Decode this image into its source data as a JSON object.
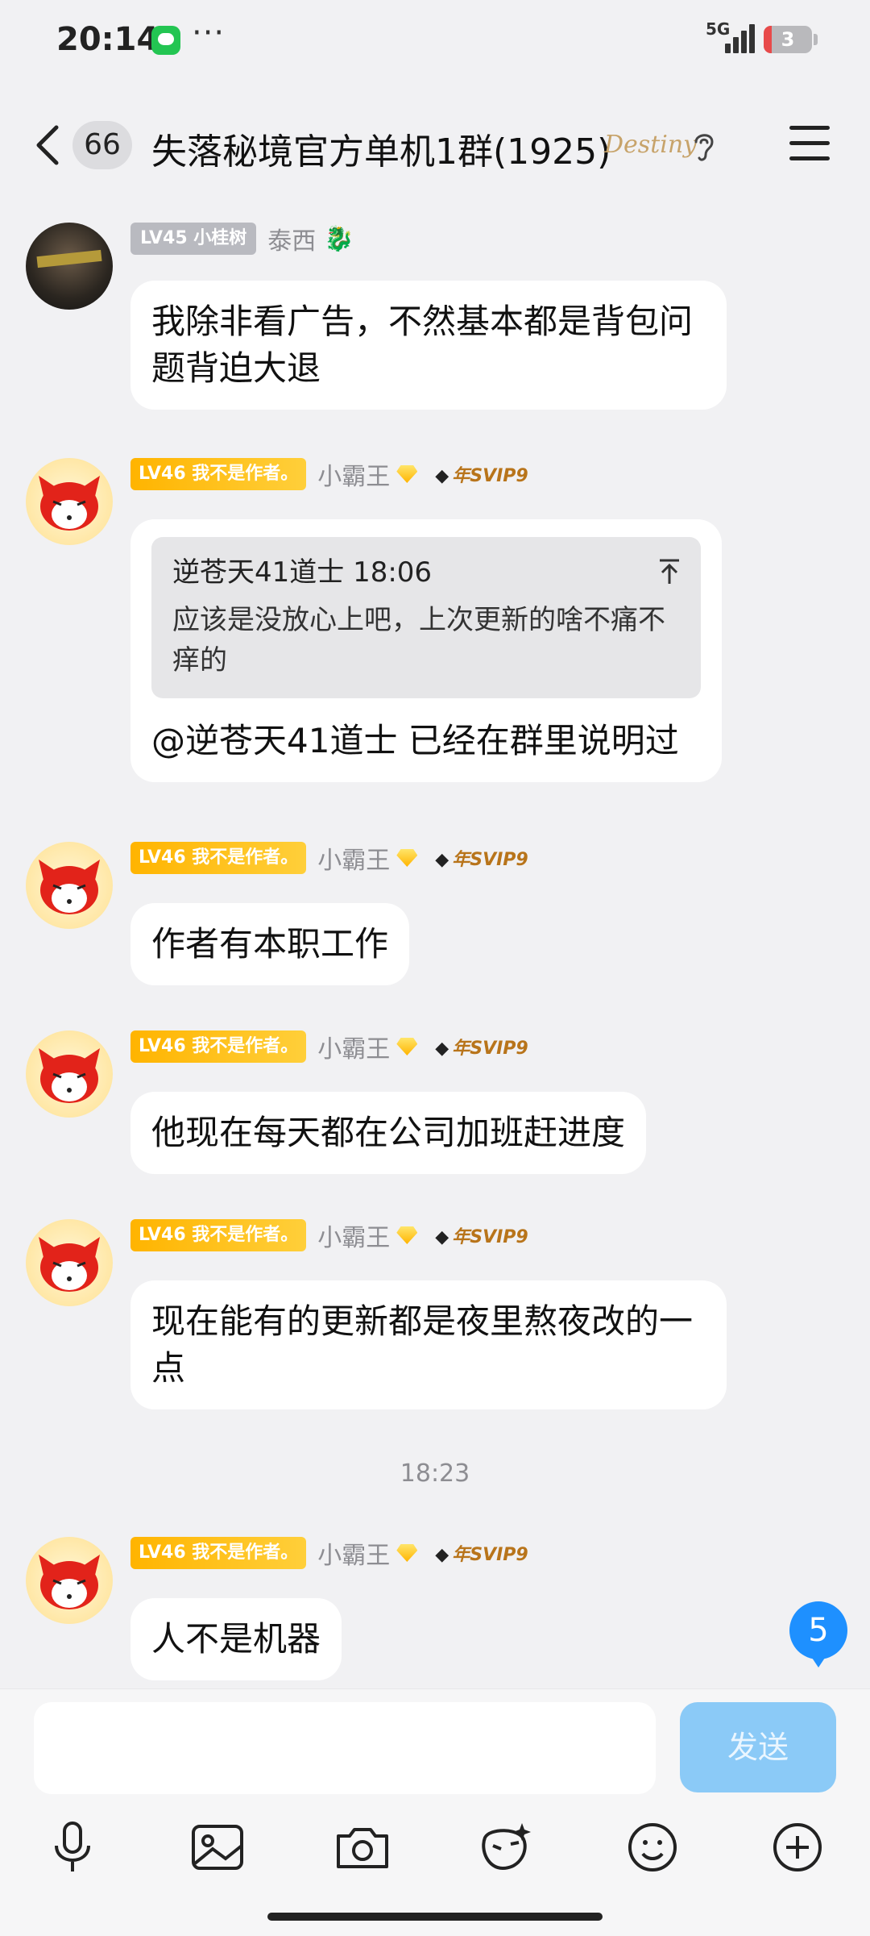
{
  "status_bar": {
    "time": "20:14",
    "network": "5G",
    "battery": "3"
  },
  "header": {
    "unread_count": "66",
    "title": "失落秘境官方单机1群(1925)",
    "title_decoration": "Destiny"
  },
  "messages": [
    {
      "level": "LV45 小桂树",
      "nickname": "泰西",
      "text": "我除非看广告，不然基本都是背包问题背迫大退"
    },
    {
      "level": "LV46 我不是作者。",
      "nickname": "小霸王",
      "svip": "年SVIP9",
      "quote": {
        "author_time": "逆苍天41道士 18:06",
        "text": "应该是没放心上吧，上次更新的啥不痛不痒的"
      },
      "text": "@逆苍天41道士 已经在群里说明过"
    },
    {
      "level": "LV46 我不是作者。",
      "nickname": "小霸王",
      "svip": "年SVIP9",
      "text": "作者有本职工作"
    },
    {
      "level": "LV46 我不是作者。",
      "nickname": "小霸王",
      "svip": "年SVIP9",
      "text": "他现在每天都在公司加班赶进度"
    },
    {
      "level": "LV46 我不是作者。",
      "nickname": "小霸王",
      "svip": "年SVIP9",
      "text": "现在能有的更新都是夜里熬夜改的一点"
    },
    {
      "level": "LV46 我不是作者。",
      "nickname": "小霸王",
      "svip": "年SVIP9",
      "text": "人不是机器"
    }
  ],
  "time_divider": "18:23",
  "new_message_count": "5",
  "composer": {
    "placeholder": "",
    "send_label": "发送"
  },
  "toolbar_icons": [
    "microphone-icon",
    "image-icon",
    "camera-icon",
    "sticker-icon",
    "emoji-icon",
    "plus-icon"
  ],
  "colors": {
    "background": "#f1f1f3",
    "send_button": "#8bcaf7",
    "level_gold": "#ffb400",
    "unread_badge": "#1e90ff"
  }
}
